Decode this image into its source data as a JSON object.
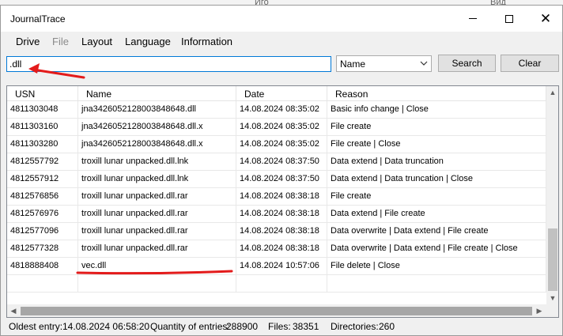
{
  "app": {
    "title": "JournalTrace"
  },
  "menu": {
    "items": [
      {
        "label": "Drive",
        "disabled": false
      },
      {
        "label": "File",
        "disabled": true
      },
      {
        "label": "Layout",
        "disabled": false
      },
      {
        "label": "Language",
        "disabled": false
      },
      {
        "label": "Information",
        "disabled": false
      }
    ]
  },
  "search": {
    "value": ".dll",
    "filter_selected": "Name",
    "search_label": "Search",
    "clear_label": "Clear"
  },
  "table": {
    "columns": [
      "USN",
      "Name",
      "Date",
      "Reason"
    ],
    "rows": [
      {
        "usn": "4811303048",
        "name": "jna3426052128003848648.dll",
        "date": "14.08.2024 08:35:02",
        "reason": "Basic info change | Close"
      },
      {
        "usn": "4811303160",
        "name": "jna3426052128003848648.dll.x",
        "date": "14.08.2024 08:35:02",
        "reason": "File create"
      },
      {
        "usn": "4811303280",
        "name": "jna3426052128003848648.dll.x",
        "date": "14.08.2024 08:35:02",
        "reason": "File create | Close"
      },
      {
        "usn": "4812557792",
        "name": "troxill lunar unpacked.dll.lnk",
        "date": "14.08.2024 08:37:50",
        "reason": "Data extend | Data truncation"
      },
      {
        "usn": "4812557912",
        "name": "troxill lunar unpacked.dll.lnk",
        "date": "14.08.2024 08:37:50",
        "reason": "Data extend | Data truncation | Close"
      },
      {
        "usn": "4812576856",
        "name": "troxill lunar unpacked.dll.rar",
        "date": "14.08.2024 08:38:18",
        "reason": "File create"
      },
      {
        "usn": "4812576976",
        "name": "troxill lunar unpacked.dll.rar",
        "date": "14.08.2024 08:38:18",
        "reason": "Data extend | File create"
      },
      {
        "usn": "4812577096",
        "name": "troxill lunar unpacked.dll.rar",
        "date": "14.08.2024 08:38:18",
        "reason": "Data overwrite | Data extend | File create"
      },
      {
        "usn": "4812577328",
        "name": "troxill lunar unpacked.dll.rar",
        "date": "14.08.2024 08:38:18",
        "reason": "Data overwrite | Data extend | File create | Close"
      },
      {
        "usn": "4818888408",
        "name": "vec.dll",
        "date": "14.08.2024 10:57:06",
        "reason": "File delete | Close"
      },
      {
        "usn": "",
        "name": "",
        "date": "",
        "reason": ""
      }
    ]
  },
  "status": {
    "oldest_label": "Oldest entry:",
    "oldest_value": "14.08.2024 06:58:20",
    "quantity_label": "Quantity of entries:",
    "quantity_value": "288900",
    "files_label": "Files:",
    "files_value": "38351",
    "dirs_label": "Directories:",
    "dirs_value": "260"
  },
  "background": {
    "text_left": "Иго",
    "text_right": "Вид"
  },
  "colors": {
    "annotation": "#e31b1b",
    "input_focus": "#0078d7"
  }
}
